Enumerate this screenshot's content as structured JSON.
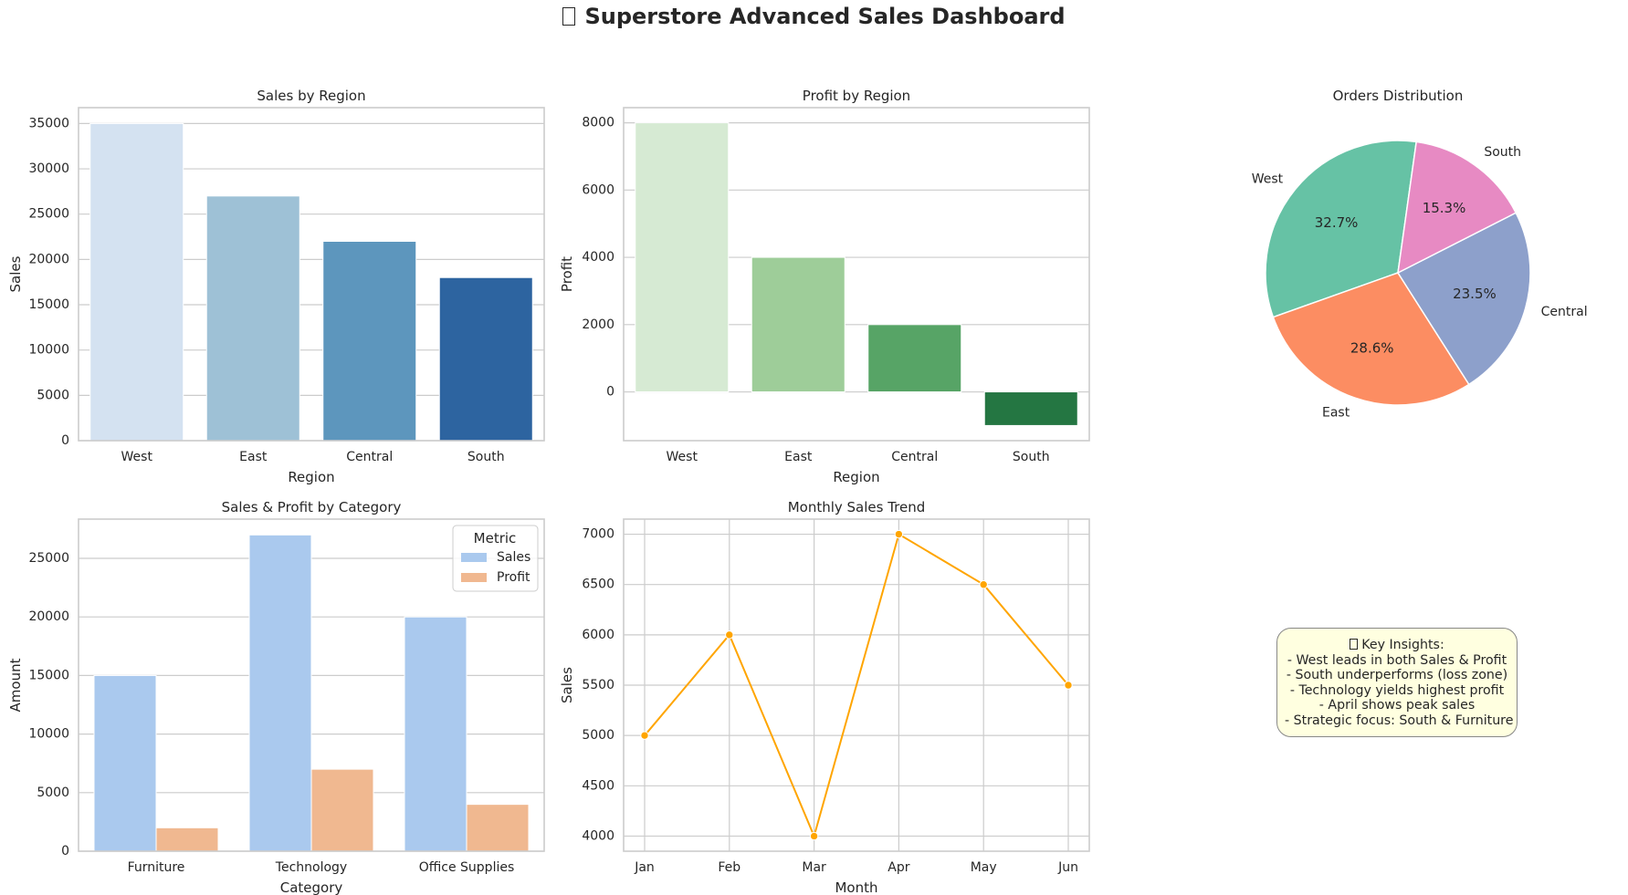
{
  "dashboard": {
    "title": "Superstore Advanced Sales Dashboard",
    "title_icon": "chart-emoji-icon"
  },
  "insights": {
    "icon": "lightbulb-emoji-icon",
    "heading": "Key Insights:",
    "lines": [
      "- West leads in both Sales & Profit",
      "- South underperforms (loss zone)",
      "- Technology yields highest profit",
      "- April shows peak sales",
      "- Strategic focus: South & Furniture"
    ]
  },
  "chart_data": [
    {
      "id": "sales_by_region",
      "type": "bar",
      "title": "Sales by Region",
      "xlabel": "Region",
      "ylabel": "Sales",
      "categories": [
        "West",
        "East",
        "Central",
        "South"
      ],
      "values": [
        35000,
        27000,
        22000,
        18000
      ],
      "colors": [
        "#d4e2f1",
        "#9ec1d6",
        "#5d96bd",
        "#2d64a0"
      ],
      "ylim": [
        0,
        36750
      ],
      "yticks": [
        0,
        5000,
        10000,
        15000,
        20000,
        25000,
        30000,
        35000
      ],
      "grid": true
    },
    {
      "id": "profit_by_region",
      "type": "bar",
      "title": "Profit by Region",
      "xlabel": "Region",
      "ylabel": "Profit",
      "categories": [
        "West",
        "East",
        "Central",
        "South"
      ],
      "values": [
        8000,
        4000,
        2000,
        -1000
      ],
      "colors": [
        "#d6ead3",
        "#9ecd99",
        "#57a466",
        "#247642"
      ],
      "ylim": [
        -1450,
        8450
      ],
      "yticks": [
        0,
        2000,
        4000,
        6000,
        8000
      ],
      "grid": true
    },
    {
      "id": "orders_distribution",
      "type": "pie",
      "title": "Orders Distribution",
      "labels": [
        "West",
        "East",
        "Central",
        "South"
      ],
      "values": [
        32.7,
        28.6,
        23.5,
        15.3
      ],
      "autopct": [
        "32.7%",
        "28.6%",
        "23.5%",
        "15.3%"
      ],
      "colors": [
        "#66c2a5",
        "#fc8d62",
        "#8da0cb",
        "#e78ac3"
      ]
    },
    {
      "id": "sales_profit_by_category",
      "type": "bar",
      "title": "Sales & Profit by Category",
      "xlabel": "Category",
      "ylabel": "Amount",
      "categories": [
        "Furniture",
        "Technology",
        "Office Supplies"
      ],
      "series": [
        {
          "name": "Sales",
          "values": [
            15000,
            27000,
            20000
          ],
          "color": "#aac9ee"
        },
        {
          "name": "Profit",
          "values": [
            2000,
            7000,
            4000
          ],
          "color": "#f0b890"
        }
      ],
      "legend_title": "Metric",
      "legend_position": "top-right",
      "ylim": [
        0,
        28350
      ],
      "yticks": [
        0,
        5000,
        10000,
        15000,
        20000,
        25000
      ],
      "grid": true
    },
    {
      "id": "monthly_sales_trend",
      "type": "line",
      "title": "Monthly Sales Trend",
      "xlabel": "Month",
      "ylabel": "Sales",
      "x": [
        "Jan",
        "Feb",
        "Mar",
        "Apr",
        "May",
        "Jun"
      ],
      "values": [
        5000,
        6000,
        4000,
        7000,
        6500,
        5500
      ],
      "color": "#ffa500",
      "ylim": [
        3850,
        7150
      ],
      "yticks": [
        4000,
        4500,
        5000,
        5500,
        6000,
        6500,
        7000
      ],
      "grid": true
    }
  ]
}
